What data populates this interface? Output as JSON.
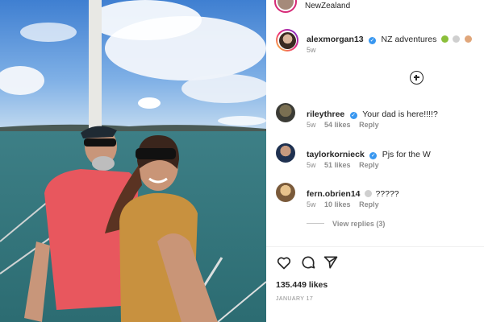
{
  "post": {
    "location": "NewZealand",
    "author": "alexmorgan13",
    "caption_text": "NZ adventures",
    "caption_time": "5w",
    "likes": "135.449 likes",
    "date": "JANUARY 17"
  },
  "comments": [
    {
      "user": "rileythree",
      "text": "Your dad is here!!!!?",
      "time": "5w",
      "likes": "54 likes",
      "reply": "Reply",
      "avatar_color": "#3b3b35"
    },
    {
      "user": "taylorkornieck",
      "text": "Pjs for the W",
      "time": "5w",
      "likes": "51 likes",
      "reply": "Reply",
      "avatar_color": "#1f3150"
    },
    {
      "user": "fern.obrien14",
      "text": "?????",
      "time": "5w",
      "likes": "10 likes",
      "reply": "Reply",
      "avatar_color": "#7a5a3a"
    }
  ],
  "view_replies": "View replies (3)",
  "icons": {
    "verified": "verified-badge-icon",
    "plus": "plus-circle-icon",
    "like": "heart-icon",
    "comment": "comment-icon",
    "share": "share-icon"
  },
  "colors": {
    "verified": "#3897f0",
    "muted_text": "#8e8e8e",
    "primary_text": "#262626"
  }
}
